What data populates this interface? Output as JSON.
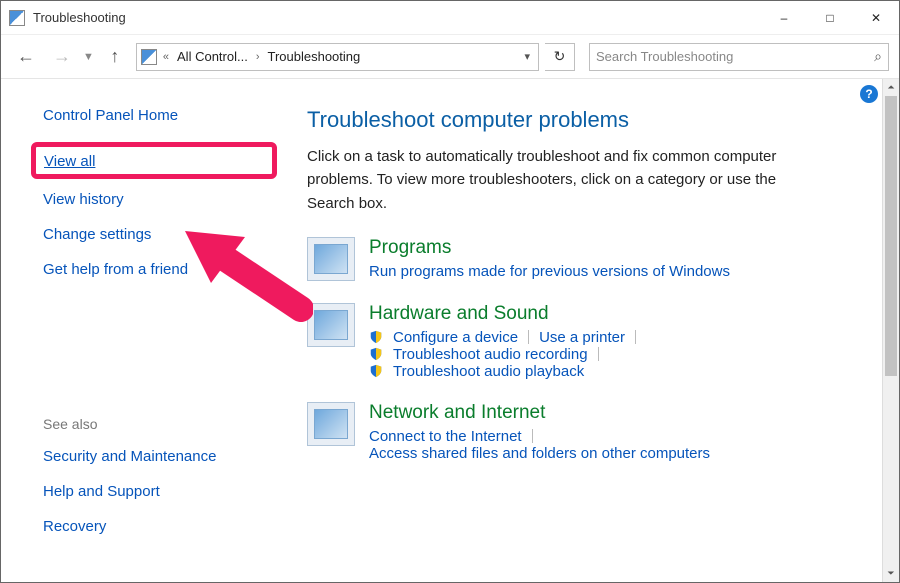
{
  "window": {
    "title": "Troubleshooting"
  },
  "nav": {
    "crumb1": "All Control...",
    "crumb2": "Troubleshooting",
    "chevron": "«"
  },
  "search": {
    "placeholder": "Search Troubleshooting"
  },
  "sidebar": {
    "home": "Control Panel Home",
    "view_all": "View all",
    "view_history": "View history",
    "change_settings": "Change settings",
    "get_help": "Get help from a friend",
    "see_also_label": "See also",
    "security": "Security and Maintenance",
    "help_support": "Help and Support",
    "recovery": "Recovery"
  },
  "main": {
    "title": "Troubleshoot computer problems",
    "desc": "Click on a task to automatically troubleshoot and fix common computer problems. To view more troubleshooters, click on a category or use the Search box.",
    "programs": {
      "title": "Programs",
      "run_compat": "Run programs made for previous versions of Windows"
    },
    "hardware": {
      "title": "Hardware and Sound",
      "configure": "Configure a device",
      "printer": "Use a printer",
      "audio_rec": "Troubleshoot audio recording",
      "audio_play": "Troubleshoot audio playback"
    },
    "network": {
      "title": "Network and Internet",
      "connect": "Connect to the Internet",
      "shared": "Access shared files and folders on other computers"
    }
  }
}
